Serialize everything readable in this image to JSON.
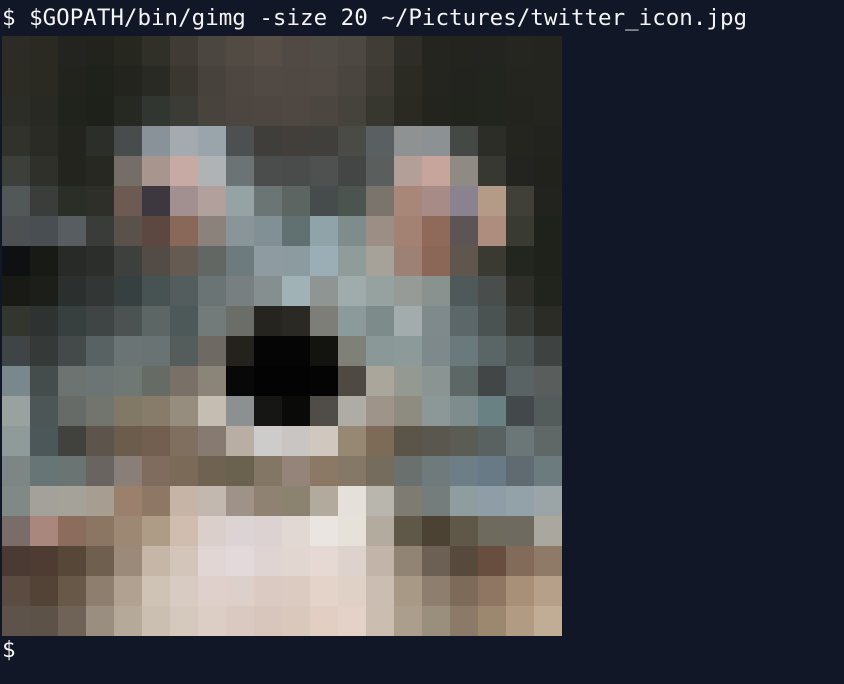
{
  "terminal": {
    "line1": {
      "prompt": "$",
      "command": "$GOPATH/bin/gimg -size 20 ~/Pictures/twitter_icon.jpg"
    },
    "line2": {
      "prompt": "$"
    }
  },
  "colors": {
    "background": "#111726",
    "foreground": "#f3f3f3"
  },
  "image": {
    "grid_size": 20,
    "pixels": [
      [
        "#2d2b25",
        "#2a2a23",
        "#23241f",
        "#22231d",
        "#26271f",
        "#302f28",
        "#403b35",
        "#4c4640",
        "#524b44",
        "#564e47",
        "#514a44",
        "#514b45",
        "#4d4841",
        "#403c36",
        "#2e2d27",
        "#25251f",
        "#23241e",
        "#23241f",
        "#25261f",
        "#24251f"
      ],
      [
        "#2c2c25",
        "#2a2a23",
        "#22231d",
        "#1f211b",
        "#23241d",
        "#292a23",
        "#3a3731",
        "#48423c",
        "#4e4741",
        "#514943",
        "#504943",
        "#514a44",
        "#4a463f",
        "#3c3a33",
        "#2b2b24",
        "#24251f",
        "#22231e",
        "#22241e",
        "#24251f",
        "#24251f"
      ],
      [
        "#2c2d26",
        "#282922",
        "#20221c",
        "#1e201a",
        "#262922",
        "#323630",
        "#3c3c36",
        "#48433d",
        "#4c4540",
        "#4e4741",
        "#4f4842",
        "#4c4640",
        "#46433d",
        "#38372f",
        "#2a2a23",
        "#23241e",
        "#21231d",
        "#22241e",
        "#23241e",
        "#24251f"
      ],
      [
        "#31322c",
        "#2a2b24",
        "#23241e",
        "#2b2e29",
        "#484c4c",
        "#8a9299",
        "#a4aab0",
        "#9aa4ab",
        "#4d5050",
        "#403e3a",
        "#423f3b",
        "#413f3b",
        "#4a4a46",
        "#5a6062",
        "#8e9293",
        "#8c9193",
        "#454946",
        "#2c2d27",
        "#24251f",
        "#22231e"
      ],
      [
        "#3d3f3b",
        "#2f302a",
        "#23241e",
        "#282822",
        "#756d68",
        "#a8958e",
        "#c7aaa3",
        "#b0b3b6",
        "#6c7375",
        "#4b4d4c",
        "#4a4c4b",
        "#4e5150",
        "#434645",
        "#5a5f5e",
        "#b39f97",
        "#c7a49c",
        "#908a84",
        "#383832",
        "#23241f",
        "#21221c"
      ],
      [
        "#525757",
        "#3a3d3a",
        "#2b2d27",
        "#2f2f2a",
        "#6d5a53",
        "#3d3840",
        "#a28f90",
        "#b1a09b",
        "#95a3a5",
        "#6b7573",
        "#5d6562",
        "#454c4b",
        "#4c5450",
        "#7a746d",
        "#a88778",
        "#a78b87",
        "#8b8290",
        "#b49b88",
        "#403f38",
        "#22231e"
      ],
      [
        "#4c5052",
        "#484e51",
        "#575d61",
        "#393c38",
        "#5a514b",
        "#5c4841",
        "#89685a",
        "#8b837b",
        "#8a9599",
        "#819095",
        "#617070",
        "#90a3a9",
        "#7f8c8c",
        "#9c8e85",
        "#a48273",
        "#8f6a5a",
        "#5d5555",
        "#ae8c7e",
        "#393a32",
        "#1f211b"
      ],
      [
        "#0f1012",
        "#181a16",
        "#282a27",
        "#2b2e2b",
        "#3d403d",
        "#534c46",
        "#665b52",
        "#626764",
        "#6e7b7e",
        "#8e9ca1",
        "#8b9b9f",
        "#9caeb5",
        "#909c9a",
        "#a6a29a",
        "#9c8174",
        "#8a6756",
        "#5f574e",
        "#3a3a33",
        "#23251f",
        "#1f211b"
      ],
      [
        "#191a16",
        "#1c1e1a",
        "#2b302e",
        "#323635",
        "#374040",
        "#465352",
        "#535d5e",
        "#6a7475",
        "#787f80",
        "#868f90",
        "#a1b2b6",
        "#8e9592",
        "#a0abab",
        "#96a2a0",
        "#979b97",
        "#8a9290",
        "#50595a",
        "#494d4c",
        "#2e2f29",
        "#21231d"
      ],
      [
        "#33352f",
        "#2e3230",
        "#38403f",
        "#3f4544",
        "#4b5251",
        "#5c6665",
        "#4d5859",
        "#727b7a",
        "#6b6e68",
        "#26241e",
        "#2a2924",
        "#7d7e78",
        "#8b9b9b",
        "#7d8b8b",
        "#a2acad",
        "#7e8a8b",
        "#5b6769",
        "#4b5352",
        "#383a35",
        "#2a2c25"
      ],
      [
        "#3f4446",
        "#353a38",
        "#444a4a",
        "#596263",
        "#6a7475",
        "#6a7373",
        "#555d5c",
        "#6e6a63",
        "#24221d",
        "#050505",
        "#050505",
        "#13130f",
        "#7f8179",
        "#8a9898",
        "#8c9a9a",
        "#7d898a",
        "#6a7a7c",
        "#5a6566",
        "#4e5555",
        "#3e4241"
      ],
      [
        "#7a888e",
        "#454c4c",
        "#6d7371",
        "#6d7574",
        "#6f7875",
        "#676b66",
        "#797167",
        "#8a8479",
        "#080808",
        "#030303",
        "#030303",
        "#040404",
        "#4e4a43",
        "#aaa69c",
        "#949a92",
        "#8a9593",
        "#5d6866",
        "#424646",
        "#5a6363",
        "#595e5c"
      ],
      [
        "#99a29f",
        "#4d5656",
        "#666b68",
        "#71756e",
        "#827866",
        "#877b6a",
        "#978d7e",
        "#c5bcb2",
        "#8d9090",
        "#161714",
        "#0a0a09",
        "#504c48",
        "#aeaca4",
        "#9e948a",
        "#8e8b81",
        "#8c9897",
        "#7d8c8c",
        "#6a8183",
        "#43494a",
        "#535b5b"
      ],
      [
        "#8f9a9a",
        "#4b5759",
        "#41423d",
        "#5d554c",
        "#6b5c4c",
        "#735f4f",
        "#806e5e",
        "#877a70",
        "#b8aea3",
        "#cdccca",
        "#c8c5c2",
        "#d0c8be",
        "#978874",
        "#7d6a57",
        "#5a5449",
        "#5a584e",
        "#5b5c54",
        "#5a6261",
        "#6b7776",
        "#5f6867"
      ],
      [
        "#7d8685",
        "#677576",
        "#6a7473",
        "#6a6460",
        "#8a7e78",
        "#7f6c5f",
        "#7c6a59",
        "#706251",
        "#6b614f",
        "#847665",
        "#958479",
        "#8b7865",
        "#867866",
        "#756c5e",
        "#69706d",
        "#6f7a7d",
        "#6e7e86",
        "#677a86",
        "#5f6b71",
        "#6c7b7d"
      ],
      [
        "#808986",
        "#a3a19a",
        "#a5a299",
        "#a79d91",
        "#9b806e",
        "#8f7766",
        "#c6b4a6",
        "#c3b8b0",
        "#9f9388",
        "#8f8273",
        "#8b8370",
        "#b1aa9d",
        "#e5e0d9",
        "#b9b6ad",
        "#7e7b72",
        "#747d7b",
        "#8f9d9f",
        "#8e9da6",
        "#93a2a8",
        "#9ba5a7"
      ],
      [
        "#7a6c68",
        "#a9877c",
        "#8c6c5d",
        "#8b7664",
        "#9d8973",
        "#ae9c86",
        "#d0bdb0",
        "#dacfcb",
        "#dcd4d4",
        "#dcd2d2",
        "#e1d8d4",
        "#ebe5e1",
        "#e6e2da",
        "#b2ab9e",
        "#5f5748",
        "#4b4233",
        "#5f5747",
        "#6e6a5e",
        "#6e6a60",
        "#a9a79e"
      ],
      [
        "#4b3a33",
        "#4e3b31",
        "#574738",
        "#6e5f4f",
        "#9b8a79",
        "#c6b6a7",
        "#d3c5ba",
        "#e1d6d3",
        "#e2dada",
        "#dfd4d1",
        "#e2d6d1",
        "#e6d9d4",
        "#ddd2cc",
        "#c2b4a8",
        "#928474",
        "#6b6053",
        "#57493c",
        "#684e3e",
        "#836b59",
        "#8e7a67"
      ],
      [
        "#5b4b41",
        "#534337",
        "#685848",
        "#8d7e6d",
        "#b0a191",
        "#cfc3b6",
        "#d8cbc1",
        "#dfd0cb",
        "#ddcfc9",
        "#dbcac2",
        "#dccbc1",
        "#e4d3c9",
        "#e0d1c6",
        "#cbbdb1",
        "#a89987",
        "#8d7e6d",
        "#7e6a58",
        "#8e7662",
        "#a88f78",
        "#b6a08a"
      ],
      [
        "#5e534a",
        "#5d5247",
        "#6f6357",
        "#9a8e80",
        "#b5a99a",
        "#cbbfb1",
        "#d5c8bc",
        "#dccdc5",
        "#dac9c1",
        "#d8c6bd",
        "#dbc8bd",
        "#e2cec2",
        "#e4d2c8",
        "#cbbdb0",
        "#ab9e8d",
        "#9a8e7c",
        "#8b7a68",
        "#9c876f",
        "#b29b83",
        "#c1ac95"
      ]
    ]
  }
}
